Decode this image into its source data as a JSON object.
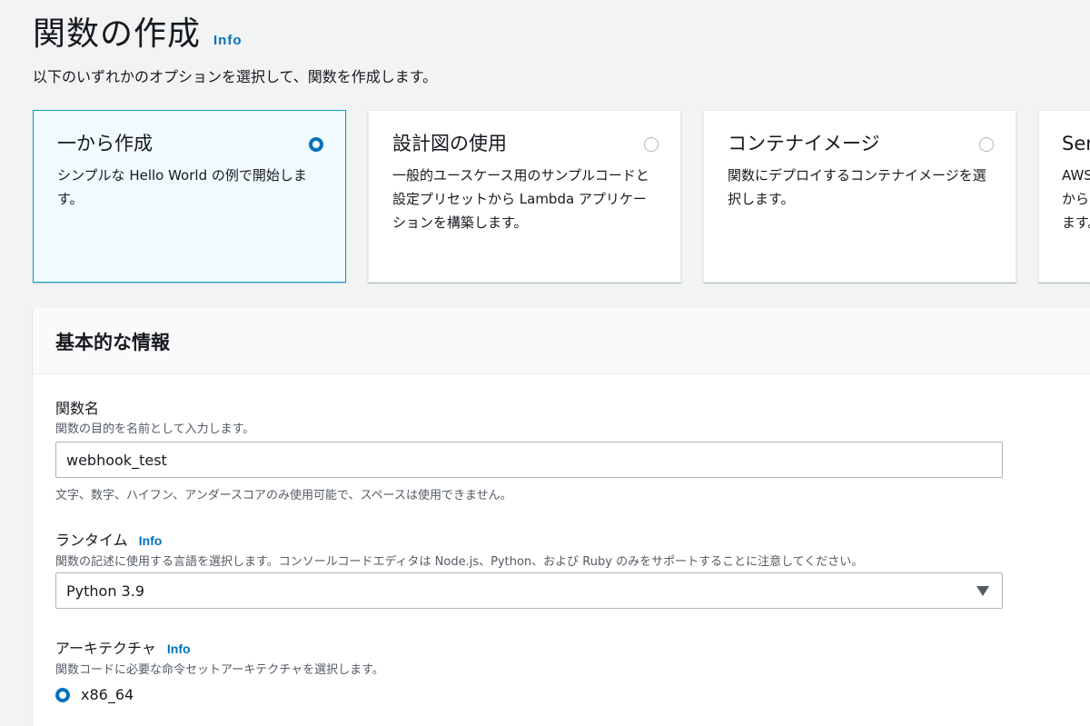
{
  "header": {
    "title": "関数の作成",
    "info": "Info",
    "description": "以下のいずれかのオプションを選択して、関数を作成します。"
  },
  "options": [
    {
      "title": "一から作成",
      "description": "シンプルな Hello World の例で開始します。",
      "selected": true
    },
    {
      "title": "設計図の使用",
      "description": "一般的ユースケース用のサンプルコードと設定プリセットから Lambda アプリケーションを構築します。",
      "selected": false
    },
    {
      "title": "コンテナイメージ",
      "description": "関数にデプロイするコンテナイメージを選択します。",
      "selected": false
    },
    {
      "title": "Serverless App Repository",
      "description": "AWS Serverless Application Repository からサンプルアプリケーションをデプロイします。",
      "selected": false
    }
  ],
  "basic_info": {
    "title": "基本的な情報",
    "function_name": {
      "label": "関数名",
      "description": "関数の目的を名前として入力します。",
      "value": "webhook_test",
      "constraint": "文字、数字、ハイフン、アンダースコアのみ使用可能で、スペースは使用できません。"
    },
    "runtime": {
      "label": "ランタイム",
      "info": "Info",
      "description": "関数の記述に使用する言語を選択します。コンソールコードエディタは Node.js、Python、および Ruby のみをサポートすることに注意してください。",
      "value": "Python 3.9"
    },
    "architecture": {
      "label": "アーキテクチャ",
      "info": "Info",
      "description": "関数コードに必要な命令セットアーキテクチャを選択します。",
      "option": "x86_64"
    }
  },
  "colors": {
    "accent": "#0073bb",
    "selected_border": "#00a1c9",
    "selected_bg": "#f1faff",
    "background": "#f2f3f3"
  }
}
